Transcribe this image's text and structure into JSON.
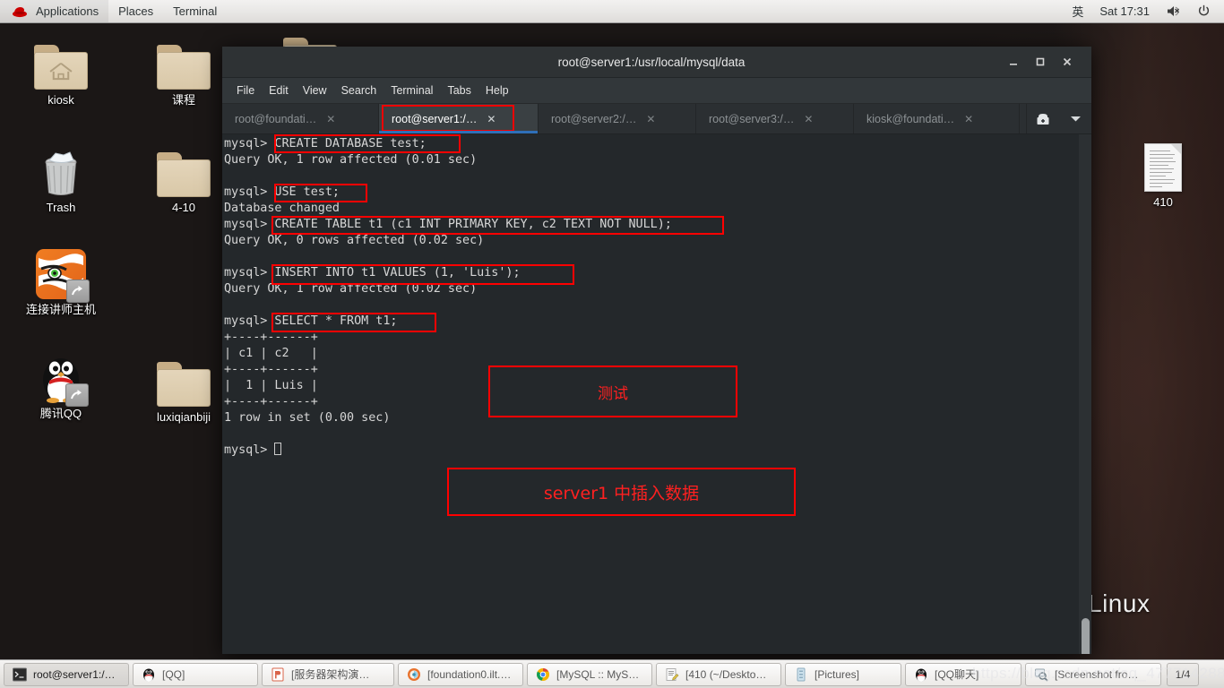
{
  "top_panel": {
    "logo": "redhat-logo",
    "menus": [
      "Applications",
      "Places",
      "Terminal"
    ],
    "input_method": "英",
    "clock": "Sat 17:31",
    "volume_icon": "volume-muted-icon",
    "power_icon": "power-icon"
  },
  "desktop": {
    "icons": [
      {
        "label": "kiosk",
        "type": "home-folder"
      },
      {
        "label": "课程",
        "type": "folder"
      },
      {
        "label": "Trash",
        "type": "trash"
      },
      {
        "label": "4-10",
        "type": "folder"
      },
      {
        "label": "连接讲师主机",
        "type": "tiger-shortcut"
      },
      {
        "label": "腾讯QQ",
        "type": "qq-shortcut"
      },
      {
        "label": "luxiqianbiji",
        "type": "folder"
      },
      {
        "label": "410",
        "type": "document"
      }
    ],
    "wallpaper_text": "Linux"
  },
  "terminal": {
    "title": "root@server1:/usr/local/mysql/data",
    "window_buttons": [
      "minimize",
      "maximize",
      "close"
    ],
    "menu": [
      "File",
      "Edit",
      "View",
      "Search",
      "Terminal",
      "Tabs",
      "Help"
    ],
    "tabs": [
      {
        "label": "root@foundati…",
        "active": false
      },
      {
        "label": "root@server1:/…",
        "active": true
      },
      {
        "label": "root@server2:/…",
        "active": false
      },
      {
        "label": "root@server3:/…",
        "active": false
      },
      {
        "label": "kiosk@foundati…",
        "active": false
      }
    ],
    "new_tab_icon": "new-tab-icon",
    "tab_list_icon": "chevron-down-icon",
    "content": "mysql> CREATE DATABASE test;\nQuery OK, 1 row affected (0.01 sec)\n\nmysql> USE test;\nDatabase changed\nmysql> CREATE TABLE t1 (c1 INT PRIMARY KEY, c2 TEXT NOT NULL);\nQuery OK, 0 rows affected (0.02 sec)\n\nmysql> INSERT INTO t1 VALUES (1, 'Luis');\nQuery OK, 1 row affected (0.02 sec)\n\nmysql> SELECT * FROM t1;\n+----+------+\n| c1 | c2   |\n+----+------+\n|  1 | Luis |\n+----+------+\n1 row in set (0.00 sec)\n\nmysql> ",
    "annotations": [
      {
        "text": "测试",
        "kind": "note"
      },
      {
        "text": "server1 中插入数据",
        "kind": "note"
      }
    ]
  },
  "taskbar": {
    "items": [
      {
        "label": "root@server1:/…",
        "icon": "terminal-icon",
        "active": true
      },
      {
        "label": "[QQ]",
        "icon": "qq-icon",
        "active": false
      },
      {
        "label": "[服务器架构演…",
        "icon": "powerpoint-icon",
        "active": false
      },
      {
        "label": "[foundation0.ilt.…",
        "icon": "vm-icon",
        "active": false
      },
      {
        "label": "[MySQL :: MyS…",
        "icon": "chrome-icon",
        "active": false
      },
      {
        "label": "[410 (~/Deskto…",
        "icon": "text-editor-icon",
        "active": false
      },
      {
        "label": "[Pictures]",
        "icon": "file-manager-icon",
        "active": false
      },
      {
        "label": "[QQ聊天]",
        "icon": "qq-icon",
        "active": false
      },
      {
        "label": "[Screenshot fro…",
        "icon": "screenshot-icon",
        "active": false
      }
    ],
    "workspace": "1/4"
  },
  "watermark": "https://blog.csdn.net/sq_477714288"
}
